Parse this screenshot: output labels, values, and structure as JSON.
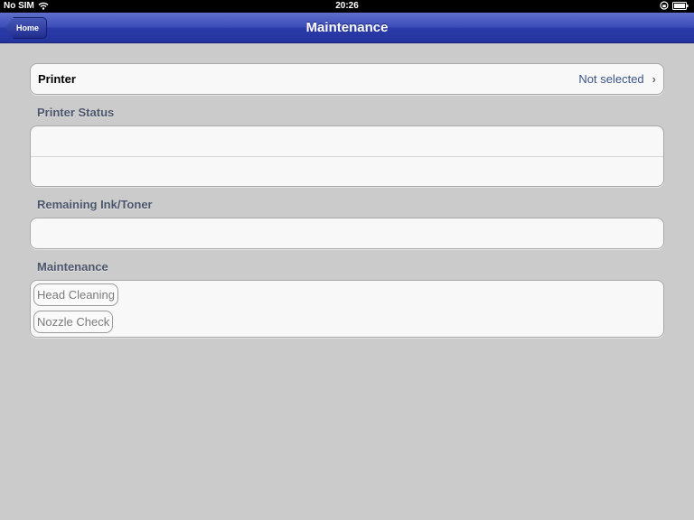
{
  "status_bar": {
    "carrier": "No SIM",
    "time": "20:26"
  },
  "nav": {
    "back_label": "Home",
    "title": "Maintenance"
  },
  "printer": {
    "label": "Printer",
    "value": "Not selected"
  },
  "sections": {
    "printer_status": "Printer Status",
    "remaining_ink": "Remaining Ink/Toner",
    "maintenance": "Maintenance"
  },
  "maintenance_actions": {
    "head_cleaning": "Head Cleaning",
    "nozzle_check": "Nozzle Check"
  },
  "colors": {
    "nav_bar": "#2a3aa8",
    "background": "#cbcbcb",
    "value_text": "#385487"
  }
}
